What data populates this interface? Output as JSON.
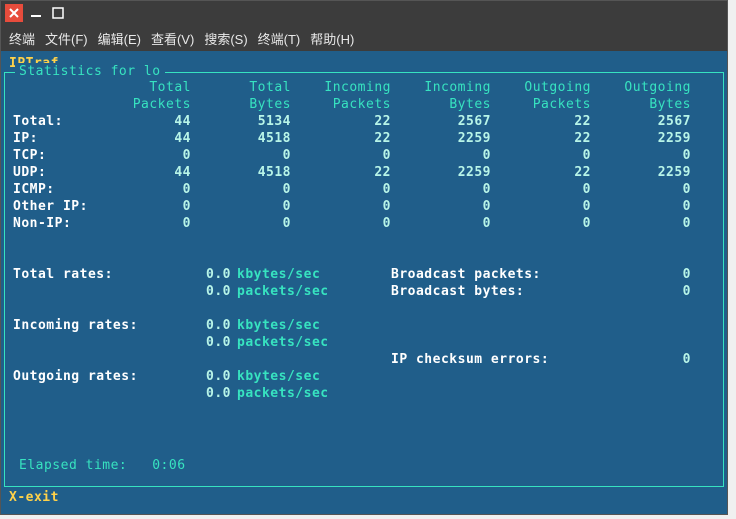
{
  "window": {
    "menus": [
      "终端",
      "文件(F)",
      "编辑(E)",
      "查看(V)",
      "搜索(S)",
      "终端(T)",
      "帮助(H)"
    ]
  },
  "app": {
    "title": "IPTraf",
    "panel_label": "Statistics for lo",
    "elapsed_label": "Elapsed time:",
    "elapsed_value": "0:06",
    "exit_hint": "X-exit"
  },
  "headers": {
    "h1a": "Total",
    "h1b": "Packets",
    "h2a": "Total",
    "h2b": "Bytes",
    "h3a": "Incoming",
    "h3b": "Packets",
    "h4a": "Incoming",
    "h4b": "Bytes",
    "h5a": "Outgoing",
    "h5b": "Packets",
    "h6a": "Outgoing",
    "h6b": "Bytes"
  },
  "rows": [
    {
      "label": "Total:",
      "v": [
        "44",
        "5134",
        "22",
        "2567",
        "22",
        "2567"
      ]
    },
    {
      "label": "IP:",
      "v": [
        "44",
        "4518",
        "22",
        "2259",
        "22",
        "2259"
      ]
    },
    {
      "label": "TCP:",
      "v": [
        "0",
        "0",
        "0",
        "0",
        "0",
        "0"
      ]
    },
    {
      "label": "UDP:",
      "v": [
        "44",
        "4518",
        "22",
        "2259",
        "22",
        "2259"
      ]
    },
    {
      "label": "ICMP:",
      "v": [
        "0",
        "0",
        "0",
        "0",
        "0",
        "0"
      ]
    },
    {
      "label": "Other IP:",
      "v": [
        "0",
        "0",
        "0",
        "0",
        "0",
        "0"
      ]
    },
    {
      "label": "Non-IP:",
      "v": [
        "0",
        "0",
        "0",
        "0",
        "0",
        "0"
      ]
    }
  ],
  "rates": {
    "total_label": "Total rates:",
    "incoming_label": "Incoming rates:",
    "outgoing_label": "Outgoing rates:",
    "kb": "0.0",
    "kb_unit": "kbytes/sec",
    "pk": "0.0",
    "pk_unit": "packets/sec"
  },
  "right": {
    "bcast_p_label": "Broadcast packets:",
    "bcast_p": "0",
    "bcast_b_label": "Broadcast bytes:",
    "bcast_b": "0",
    "ipck_label": "IP checksum errors:",
    "ipck": "0"
  }
}
